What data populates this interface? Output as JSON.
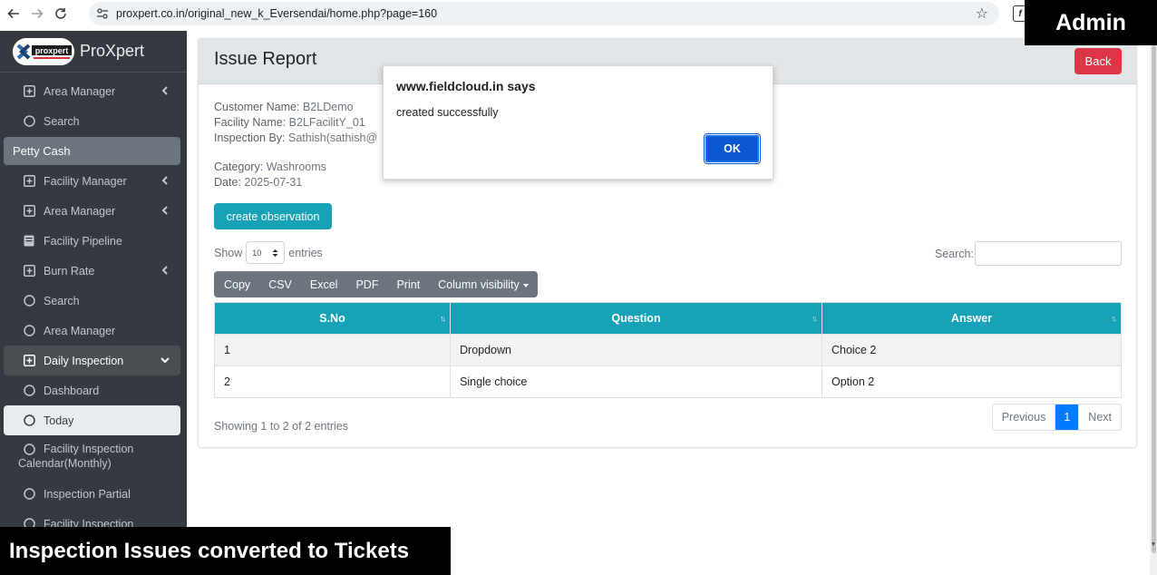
{
  "browser": {
    "url": "proxpert.co.in/original_new_k_Eversendai/home.php?page=160",
    "ext_letter": "f"
  },
  "overlays": {
    "admin": "Admin",
    "caption": "Inspection Issues converted to Tickets"
  },
  "sidebar": {
    "brand": "ProXpert",
    "logo_text": "proxpert",
    "items": [
      {
        "label": "Area Manager",
        "icon": "plus-square-icon",
        "chevron": "left"
      },
      {
        "label": "Search",
        "icon": "circle-icon"
      },
      {
        "label": "Petty Cash",
        "type": "header"
      },
      {
        "label": "Facility Manager",
        "icon": "plus-square-icon",
        "chevron": "left"
      },
      {
        "label": "Area Manager",
        "icon": "plus-square-icon",
        "chevron": "left"
      },
      {
        "label": "Facility Pipeline",
        "icon": "book-icon"
      },
      {
        "label": "Burn Rate",
        "icon": "plus-square-icon",
        "chevron": "left"
      },
      {
        "label": "Search",
        "icon": "circle-icon"
      },
      {
        "label": "Area Manager",
        "icon": "circle-icon"
      },
      {
        "label": "Daily Inspection",
        "icon": "plus-square-icon",
        "chevron": "down",
        "state": "open"
      },
      {
        "label": "Dashboard",
        "icon": "circle-icon"
      },
      {
        "label": "Today",
        "icon": "circle-icon",
        "state": "active"
      },
      {
        "label_line1": "Facility Inspection",
        "label_line2": "Calendar(Monthly)",
        "icon": "circle-icon"
      },
      {
        "label": "Inspection Partial",
        "icon": "circle-icon"
      },
      {
        "label": "Facility Inspection",
        "icon": "circle-icon"
      }
    ]
  },
  "card": {
    "title": "Issue Report",
    "back_label": "Back",
    "customer_label": "Customer Name:",
    "customer_value": "B2LDemo",
    "facility_label": "Facility Name:",
    "facility_value": "B2LFacilitY_01",
    "inspection_label": "Inspection By:",
    "inspection_value": "Sathish(sathish@",
    "category_label": "Category:",
    "category_value": "Washrooms",
    "date_label": "Date:",
    "date_value": "2025-07-31",
    "create_label": "create observation"
  },
  "datatable": {
    "show_label": "Show",
    "page_size": "10",
    "entries_label": "entries",
    "search_label": "Search:",
    "buttons": [
      "Copy",
      "CSV",
      "Excel",
      "PDF",
      "Print",
      "Column visibility"
    ],
    "columns": [
      "S.No",
      "Question",
      "Answer"
    ],
    "rows": [
      [
        "1",
        "Dropdown",
        "Choice 2"
      ],
      [
        "2",
        "Single choice",
        "Option 2"
      ]
    ],
    "summary": "Showing 1 to 2 of 2 entries",
    "pager": {
      "previous": "Previous",
      "current": "1",
      "next": "Next"
    }
  },
  "dialog": {
    "title": "www.fieldcloud.in says",
    "message": "created successfully",
    "ok_label": "OK"
  },
  "colors": {
    "sidebar_bg": "#343a40",
    "teal": "#17a2b8",
    "danger": "#dc3545",
    "primary": "#007bff",
    "dialog_ok": "#0b57d0"
  }
}
